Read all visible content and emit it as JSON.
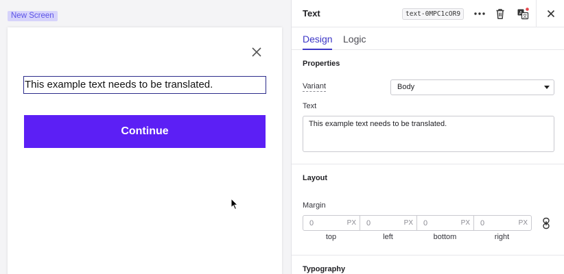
{
  "canvas": {
    "screen_label": "New Screen",
    "body_text": "This example text needs to be translated.",
    "continue_label": "Continue"
  },
  "panel": {
    "title": "Text",
    "element_id": "text-0MPC1cOR9",
    "icons": [
      "more-icon",
      "trash-icon",
      "translate-icon",
      "close-icon"
    ],
    "tabs": [
      {
        "label": "Design",
        "active": true
      },
      {
        "label": "Logic",
        "active": false
      }
    ],
    "properties": {
      "title": "Properties",
      "variant_label": "Variant",
      "variant_value": "Body",
      "text_label": "Text",
      "text_value": "This example text needs to be translated."
    },
    "layout": {
      "title": "Layout",
      "margin_label": "Margin",
      "margins": [
        {
          "label": "top",
          "value": "0",
          "unit": "PX"
        },
        {
          "label": "left",
          "value": "0",
          "unit": "PX"
        },
        {
          "label": "bottom",
          "value": "0",
          "unit": "PX"
        },
        {
          "label": "right",
          "value": "0",
          "unit": "PX"
        }
      ]
    },
    "typography": {
      "title": "Typography"
    }
  },
  "colors": {
    "accent": "#3b35c6",
    "button": "#5c1ff5",
    "badge_bg": "#d6d3fb",
    "notification_dot": "#e5484d"
  }
}
